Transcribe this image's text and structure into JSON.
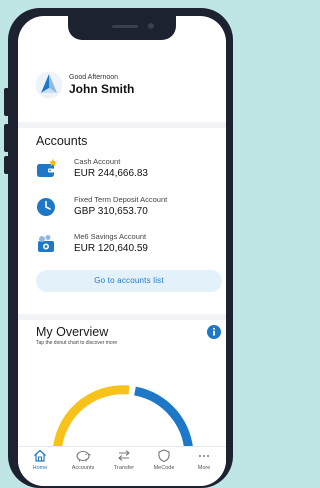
{
  "header": {
    "greeting": "Good Afternoon",
    "user_name": "John Smith"
  },
  "accounts": {
    "title": "Accounts",
    "items": [
      {
        "name": "Cash Account",
        "amount": "EUR 244,666.83",
        "icon": "wallet-icon"
      },
      {
        "name": "Fixed Term Deposit Account",
        "amount": "GBP 310,653.70",
        "icon": "clock-icon"
      },
      {
        "name": "Me6 Savings Account",
        "amount": "EUR 120,640.59",
        "icon": "coins-icon"
      }
    ],
    "list_button": "Go to accounts list"
  },
  "overview": {
    "title": "My Overview",
    "subtitle": "Tap the donut chart to discover more",
    "info_icon": "info-icon"
  },
  "tabs": [
    {
      "label": "Home",
      "icon": "home-icon",
      "active": true
    },
    {
      "label": "Accounts",
      "icon": "piggy-bank-icon",
      "active": false
    },
    {
      "label": "Transfer",
      "icon": "transfer-icon",
      "active": false
    },
    {
      "label": "MeCode",
      "icon": "shield-icon",
      "active": false
    },
    {
      "label": "More",
      "icon": "more-icon",
      "active": false
    }
  ],
  "colors": {
    "accent": "#1e78c8",
    "star": "#f5b800",
    "donut_yellow": "#f7c21a",
    "donut_blue": "#1e78c8"
  }
}
